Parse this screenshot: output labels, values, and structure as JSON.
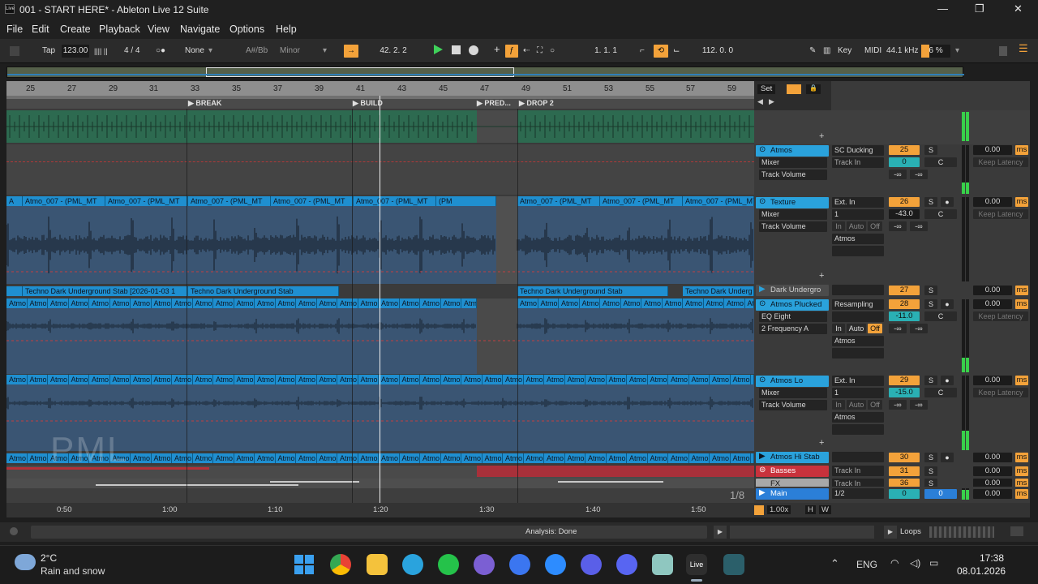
{
  "window": {
    "title": "001 - START HERE* - Ableton Live 12 Suite",
    "controls": [
      "—",
      "❐",
      "✕"
    ]
  },
  "menu": [
    "File",
    "Edit",
    "Create",
    "Playback",
    "View",
    "Navigate",
    "Options",
    "Help"
  ],
  "toolbar": {
    "tap": "Tap",
    "tempo": "123.00",
    "meter_glyph": "|||| ||",
    "signature": "4 / 4",
    "metronome": "○●",
    "quantize": "None",
    "key": "A#/Bb",
    "scale": "Minor",
    "position": "42.  2.  2",
    "loop_start": "1.   1.   1",
    "loop_length": "112.   0.   0",
    "key_label": "Key",
    "midi_label": "MIDI",
    "sample_rate": "44.1 kHz",
    "cpu": "6 %"
  },
  "ruler": {
    "bars": [
      "25",
      "27",
      "29",
      "31",
      "33",
      "35",
      "37",
      "39",
      "41",
      "43",
      "45",
      "47",
      "49",
      "51",
      "53",
      "55",
      "57",
      "59"
    ],
    "set_button": "Set"
  },
  "locators": [
    "BREAK",
    "BUILD",
    "PRED...",
    "DROP 2"
  ],
  "clips": {
    "texture": "Atmo_007 - (PML_MT",
    "texture_short": "(PM",
    "first": "A",
    "dark_1": "Techno Dark Underground Stab [2026-01-03 1",
    "dark_2": "Techno Dark Underground Stab",
    "dark_3": "Techno Dark Underground Stab",
    "dark_4": "Techno Dark Underg",
    "atmo_short": "Atmo",
    "atmo_last": "A"
  },
  "watermark": "PML",
  "zoom_fraction": "1/8",
  "tracks": [
    {
      "name": "Atmos",
      "device": "Mixer",
      "param": "Track Volume",
      "input": "SC Ducking",
      "input2": "Track In",
      "number": "25",
      "vol": "0",
      "pan": "C",
      "inf1": "-∞",
      "inf2": "-∞",
      "delay": "0.00",
      "unit": "ms",
      "latency": "Keep Latency"
    },
    {
      "name": "Texture",
      "device": "Mixer",
      "param": "Track Volume",
      "input": "Ext. In",
      "input2": "1",
      "number": "26",
      "vol": "-43.0",
      "pan": "C",
      "inf1": "-∞",
      "inf2": "-∞",
      "delay": "0.00",
      "unit": "ms",
      "latency": "Keep Latency",
      "monitor": [
        "In",
        "Auto",
        "Off"
      ],
      "output": "Atmos"
    },
    {
      "name": "Dark Undergro",
      "number": "27",
      "delay": "0.00",
      "unit": "ms"
    },
    {
      "name": "Atmos Plucked",
      "device": "EQ Eight",
      "param": "2 Frequency A",
      "input": "Resampling",
      "number": "28",
      "vol": "-11.0",
      "pan": "C",
      "inf1": "-∞",
      "inf2": "-∞",
      "delay": "0.00",
      "unit": "ms",
      "latency": "Keep Latency",
      "monitor": [
        "In",
        "Auto",
        "Off"
      ],
      "output": "Atmos"
    },
    {
      "name": "Atmos Lo",
      "device": "Mixer",
      "param": "Track Volume",
      "input": "Ext. In",
      "input2": "1",
      "number": "29",
      "vol": "-15.0",
      "pan": "C",
      "inf1": "-∞",
      "inf2": "-∞",
      "delay": "0.00",
      "unit": "ms",
      "latency": "Keep Latency",
      "monitor": [
        "In",
        "Auto",
        "Off"
      ],
      "output": "Atmos"
    },
    {
      "name": "Atmos Hi Stab",
      "number": "30",
      "delay": "0.00",
      "unit": "ms"
    },
    {
      "name": "Basses",
      "input": "Track In",
      "number": "31",
      "delay": "0.00",
      "unit": "ms"
    },
    {
      "name": "FX",
      "input": "Track In",
      "number": "36",
      "delay": "0.00",
      "unit": "ms"
    },
    {
      "name": "Main",
      "input": "1/2",
      "vol": "0",
      "pan": "0",
      "delay": "0.00",
      "unit": "ms"
    }
  ],
  "solo_label": "S",
  "time_ruler": [
    "0:50",
    "1:00",
    "1:10",
    "1:20",
    "1:30",
    "1:40",
    "1:50"
  ],
  "zoom_rate": "1.00x",
  "h_label": "H",
  "w_label": "W",
  "status": {
    "analysis": "Analysis: Done",
    "loops": "Loops"
  },
  "taskbar": {
    "weather_temp": "2°C",
    "weather_desc": "Rain and snow",
    "lang": "ENG",
    "time": "17:38",
    "date": "08.01.2026",
    "live_label": "Live"
  },
  "colors": {
    "accent": "#f3a23a",
    "clip_blue": "#1f8fd0",
    "track_active": "#2aa2dc",
    "basses": "#c8323c",
    "meter": "#38d04a"
  }
}
